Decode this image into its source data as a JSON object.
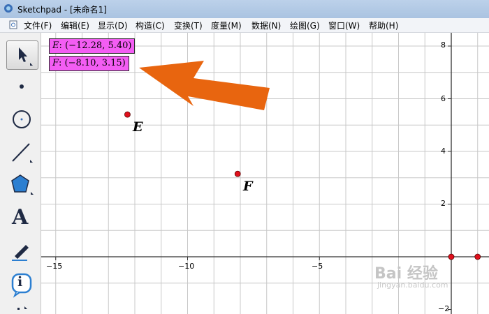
{
  "window": {
    "title": "Sketchpad  - [未命名1]"
  },
  "menu": [
    "文件(F)",
    "编辑(E)",
    "显示(D)",
    "构造(C)",
    "变换(T)",
    "度量(M)",
    "数据(N)",
    "绘图(G)",
    "窗口(W)",
    "帮助(H)"
  ],
  "toolbar": {
    "tools": [
      "selection-arrow-tool",
      "point-tool",
      "compass-tool",
      "straightedge-tool",
      "polygon-tool",
      "text-tool",
      "marker-tool",
      "information-tool",
      "custom-tool"
    ],
    "text_tool_glyph": "A",
    "info_tool_glyph": "i"
  },
  "measurements": [
    {
      "point": "E",
      "value": ": (−12.28, 5.40)"
    },
    {
      "point": "F",
      "value": ": (−8.10, 3.15)"
    }
  ],
  "points": [
    {
      "label": "E",
      "x": -12.28,
      "y": 5.4
    },
    {
      "label": "F",
      "x": -8.1,
      "y": 3.15
    }
  ],
  "origin_points": [
    {
      "x": 0,
      "y": 0
    },
    {
      "x": 1,
      "y": 0
    }
  ],
  "axes": {
    "x_ticks": [
      "−15",
      "−10",
      "−5"
    ],
    "y_ticks": [
      "8",
      "6",
      "4",
      "2",
      "−2"
    ]
  },
  "colors": {
    "point": "#e0101c",
    "arrow": "#e8650f",
    "measure_bg": "#f35df3",
    "grid": "#c8c8c8"
  },
  "watermark": {
    "text": "Bai 经验",
    "sub": "jingyan.baidu.com"
  }
}
